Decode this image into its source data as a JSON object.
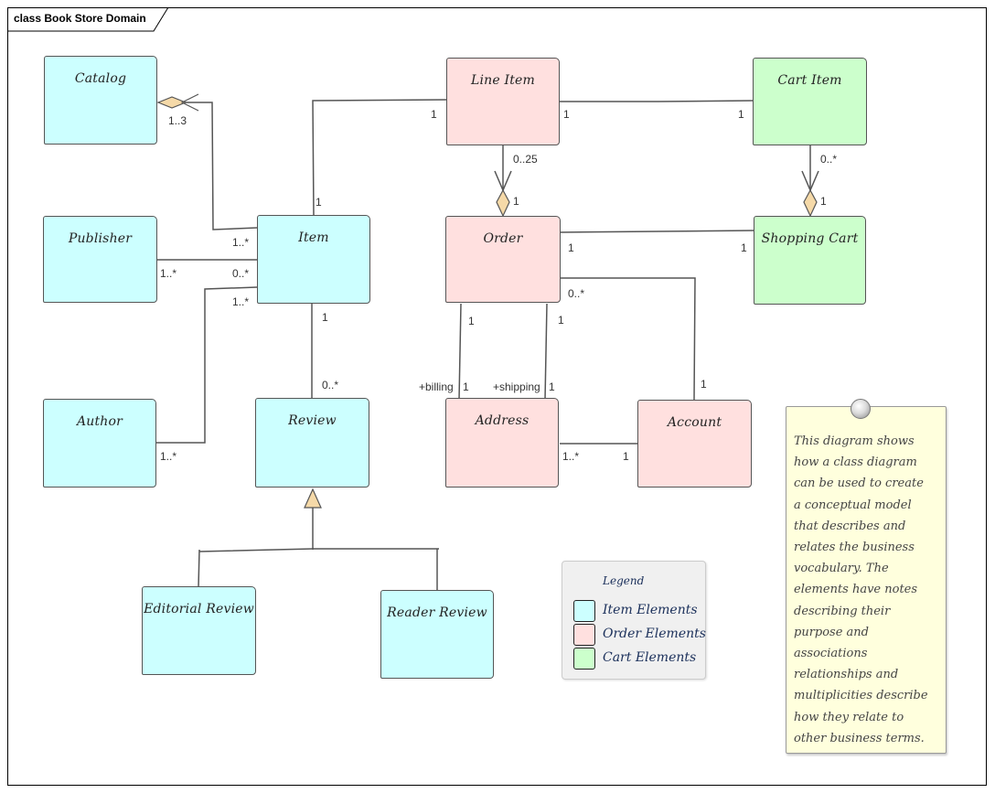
{
  "diagram": {
    "title": "class Book Store Domain",
    "colors": {
      "item_elements": "#ccffff",
      "order_elements": "#ffe0df",
      "cart_elements": "#ccffcc",
      "diamond": "#f5d9a8",
      "note": "#ffffdd",
      "legend_bg": "#f0f0f0",
      "line": "#555555"
    },
    "classes": {
      "catalog": "Catalog",
      "publisher": "Publisher",
      "author": "Author",
      "item": "Item",
      "review": "Review",
      "editorial_review": "Editorial Review",
      "reader_review": "Reader Review",
      "line_item": "Line Item",
      "order": "Order",
      "address": "Address",
      "account": "Account",
      "cart_item": "Cart Item",
      "shopping_cart": "Shopping Cart"
    },
    "associations": [
      {
        "from": "Catalog",
        "to": "Item",
        "kind": "aggregation",
        "catalog_end": "1..3",
        "item_end": "1..*"
      },
      {
        "from": "Publisher",
        "to": "Item",
        "kind": "association",
        "publisher_end": "1..*",
        "item_end": "0..*"
      },
      {
        "from": "Author",
        "to": "Item",
        "kind": "association",
        "author_end": "1..*",
        "item_end": "1..*"
      },
      {
        "from": "Item",
        "to": "Line Item",
        "kind": "association",
        "item_end": "1",
        "line_item_end": "1"
      },
      {
        "from": "Item",
        "to": "Review",
        "kind": "association",
        "item_end": "1",
        "review_end": "0..*"
      },
      {
        "from": "Line Item",
        "to": "Cart Item",
        "kind": "association",
        "line_item_end": "1",
        "cart_item_end": "1"
      },
      {
        "from": "Line Item",
        "to": "Order",
        "kind": "aggregation",
        "line_item_end": "0..25",
        "order_end": "1"
      },
      {
        "from": "Cart Item",
        "to": "Shopping Cart",
        "kind": "aggregation",
        "cart_item_end": "0..*",
        "shopping_cart_end": "1"
      },
      {
        "from": "Order",
        "to": "Shopping Cart",
        "kind": "association",
        "order_end": "1",
        "shopping_cart_end": "1"
      },
      {
        "from": "Order",
        "to": "Account",
        "kind": "association",
        "order_end": "0..*",
        "account_end": "1"
      },
      {
        "from": "Order",
        "to": "Address",
        "kind": "association",
        "role": "+billing",
        "order_end": "1",
        "address_end": "1"
      },
      {
        "from": "Order",
        "to": "Address",
        "kind": "association",
        "role": "+shipping",
        "order_end": "1",
        "address_end": "1"
      },
      {
        "from": "Address",
        "to": "Account",
        "kind": "association",
        "address_end": "1..*",
        "account_end": "1"
      },
      {
        "from": "Editorial Review",
        "to": "Review",
        "kind": "generalization"
      },
      {
        "from": "Reader Review",
        "to": "Review",
        "kind": "generalization"
      }
    ],
    "labels": {
      "catalog_item_catalog": "1..3",
      "catalog_item_item": "1..*",
      "publisher_item_publisher": "1..*",
      "publisher_item_item": "0..*",
      "author_item_item": "1..*",
      "author_item_author": "1..*",
      "item_lineitem_item": "1",
      "item_lineitem_lineitem": "1",
      "item_review_item": "1",
      "item_review_review": "0..*",
      "lineitem_cartitem_lineitem": "1",
      "lineitem_cartitem_cartitem": "1",
      "lineitem_order_lineitem": "0..25",
      "lineitem_order_order": "1",
      "cartitem_cart_cartitem": "0..*",
      "cartitem_cart_cart": "1",
      "order_cart_order": "1",
      "order_cart_cart": "1",
      "order_account_order": "0..*",
      "order_account_account": "1",
      "order_billing_order": "1",
      "order_shipping_order": "1",
      "billing_role": "+billing",
      "billing_mult": "1",
      "shipping_role": "+shipping",
      "shipping_mult": "1",
      "address_account_address": "1..*",
      "address_account_account": "1"
    },
    "legend": {
      "title": "Legend",
      "items": [
        {
          "label": "Item Elements",
          "color": "#ccffff"
        },
        {
          "label": "Order Elements",
          "color": "#ffe0df"
        },
        {
          "label": "Cart Elements",
          "color": "#ccffcc"
        }
      ]
    },
    "note": {
      "text": "This diagram shows\nhow a class diagram\ncan be used to create\na conceptual model\nthat describes and\nrelates the business\nvocabulary. The\nelements have notes\ndescribing their\npurpose and\nassociations\nrelationships and\nmultiplicities describe\nhow they relate to\nother business terms."
    }
  }
}
